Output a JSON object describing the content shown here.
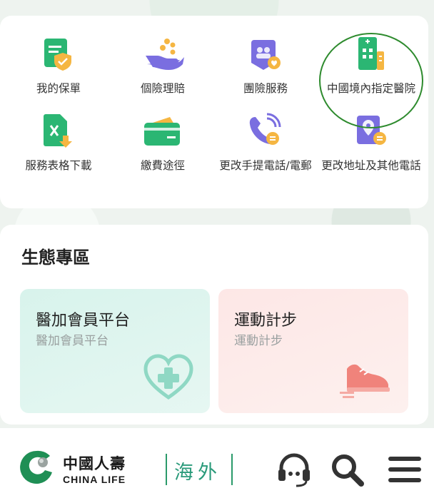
{
  "services": [
    {
      "label": "我的保單",
      "icon": "policy-document-icon"
    },
    {
      "label": "個險理賠",
      "icon": "hand-coins-icon"
    },
    {
      "label": "團險服務",
      "icon": "group-insurance-icon"
    },
    {
      "label": "中國境內指定醫院",
      "icon": "hospital-building-icon"
    },
    {
      "label": "服務表格下載",
      "icon": "excel-download-icon"
    },
    {
      "label": "繳費途徑",
      "icon": "wallet-icon"
    },
    {
      "label": "更改手提電話/電郵",
      "icon": "phone-change-icon"
    },
    {
      "label": "更改地址及其他電話",
      "icon": "address-change-icon"
    }
  ],
  "ecosystem": {
    "title": "生態專區",
    "tiles": [
      {
        "title": "醫加會員平台",
        "subtitle": "醫加會員平台",
        "icon": "heart-plus-icon"
      },
      {
        "title": "運動計步",
        "subtitle": "運動計步",
        "icon": "sneaker-icon"
      }
    ]
  },
  "footer": {
    "brand_cn": "中國人壽",
    "brand_en": "CHINA LIFE",
    "brand_region": "海外",
    "icons": [
      "customer-service-headset-icon",
      "search-icon",
      "menu-icon"
    ]
  },
  "colors": {
    "brand_green": "#1f8f55",
    "icon_green": "#2bb673",
    "icon_purple": "#7a6ee0",
    "icon_orange": "#f5b642",
    "highlight_ring": "#2e8b2e"
  }
}
